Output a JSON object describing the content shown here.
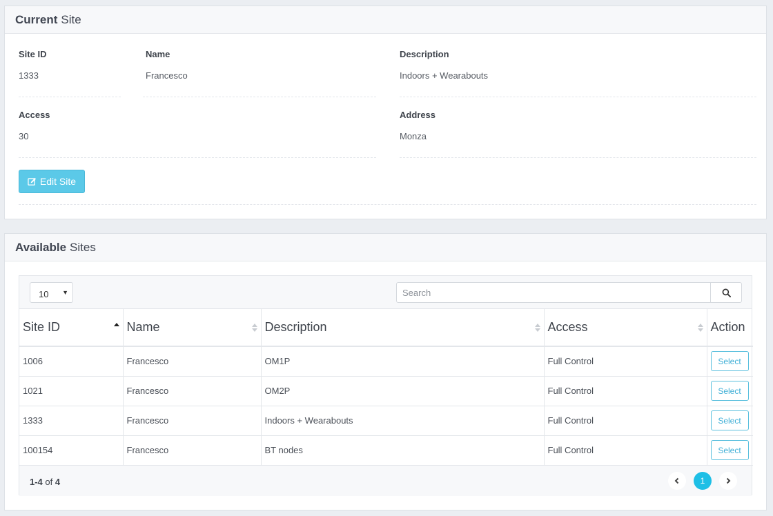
{
  "current_site": {
    "header_strong": "Current",
    "header_rest": "Site",
    "fields": {
      "site_id": {
        "label": "Site ID",
        "value": "1333"
      },
      "name": {
        "label": "Name",
        "value": "Francesco"
      },
      "description": {
        "label": "Description",
        "value": "Indoors + Wearabouts"
      },
      "access": {
        "label": "Access",
        "value": "30"
      },
      "address": {
        "label": "Address",
        "value": "Monza"
      }
    },
    "edit_button_label": "Edit Site"
  },
  "available_sites": {
    "header_strong": "Available",
    "header_rest": "Sites",
    "page_size": "10",
    "search_placeholder": "Search",
    "columns": [
      "Site ID",
      "Name",
      "Description",
      "Access",
      "Action"
    ],
    "rows": [
      {
        "site_id": "1006",
        "name": "Francesco",
        "description": "OM1P",
        "access": "Full Control",
        "action": "Select"
      },
      {
        "site_id": "1021",
        "name": "Francesco",
        "description": "OM2P",
        "access": "Full Control",
        "action": "Select"
      },
      {
        "site_id": "1333",
        "name": "Francesco",
        "description": "Indoors + Wearabouts",
        "access": "Full Control",
        "action": "Select"
      },
      {
        "site_id": "100154",
        "name": "Francesco",
        "description": "BT nodes",
        "access": "Full Control",
        "action": "Select"
      }
    ],
    "summary": {
      "range": "1-4",
      "of": "of",
      "total": "4"
    },
    "pagination": {
      "current_page": "1"
    }
  },
  "colors": {
    "accent": "#1ebfe6",
    "edit_button": "#5bc9e8",
    "select_border": "#5bc0de"
  },
  "icons": {
    "edit": "edit-icon",
    "search": "search-icon",
    "sort_asc": "sort-asc-icon",
    "sort_both": "sort-icon",
    "prev": "chevron-left-icon",
    "next": "chevron-right-icon"
  }
}
